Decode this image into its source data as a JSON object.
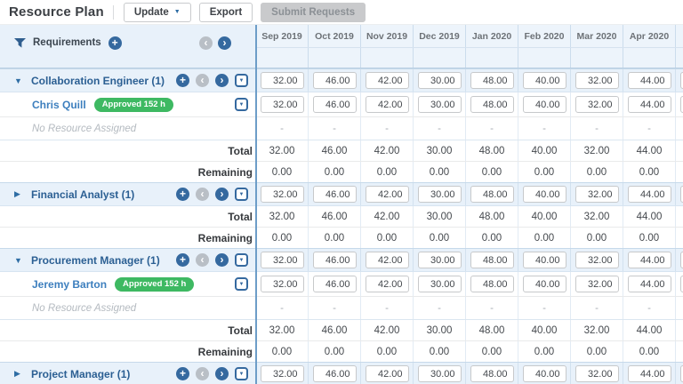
{
  "toolbar": {
    "title": "Resource Plan",
    "update_label": "Update",
    "export_label": "Export",
    "submit_label": "Submit Requests"
  },
  "panel": {
    "requirements_label": "Requirements"
  },
  "months": [
    "Sep 2019",
    "Oct 2019",
    "Nov 2019",
    "Dec 2019",
    "Jan 2020",
    "Feb 2020",
    "Mar 2020",
    "Apr 2020"
  ],
  "labels": {
    "total": "Total",
    "remaining": "Remaining",
    "no_resource": "No Resource Assigned"
  },
  "cell_values": {
    "hours": [
      "32.00",
      "46.00",
      "42.00",
      "30.00",
      "48.00",
      "40.00",
      "32.00",
      "44.00"
    ],
    "zeros": [
      "0.00",
      "0.00",
      "0.00",
      "0.00",
      "0.00",
      "0.00",
      "0.00",
      "0.00"
    ],
    "dash": "-"
  },
  "colors": {
    "accent_blue": "#35699f",
    "light_blue_row": "#e8f1fa",
    "badge_green": "#3eb962",
    "grid_divider_blue": "#6d9dc8"
  },
  "rows": [
    {
      "kind": "role",
      "label": "Collaboration Engineer (1)",
      "expanded": true,
      "cells": "inputs"
    },
    {
      "kind": "person",
      "label": "Chris Quill",
      "badge": "Approved 152 h",
      "cells": "inputs"
    },
    {
      "kind": "nores",
      "cells": "dash"
    },
    {
      "kind": "total",
      "cells": "hours"
    },
    {
      "kind": "remaining",
      "cells": "zeros"
    },
    {
      "kind": "role",
      "label": "Financial Analyst (1)",
      "expanded": false,
      "cells": "inputs"
    },
    {
      "kind": "total",
      "cells": "hours"
    },
    {
      "kind": "remaining",
      "cells": "zeros"
    },
    {
      "kind": "role",
      "label": "Procurement Manager (1)",
      "expanded": true,
      "cells": "inputs"
    },
    {
      "kind": "person",
      "label": "Jeremy Barton",
      "badge": "Approved 152 h",
      "cells": "inputs"
    },
    {
      "kind": "nores",
      "cells": "dash"
    },
    {
      "kind": "total",
      "cells": "hours"
    },
    {
      "kind": "remaining",
      "cells": "zeros"
    },
    {
      "kind": "role",
      "label": "Project Manager (1)",
      "expanded": false,
      "cells": "inputs"
    }
  ]
}
